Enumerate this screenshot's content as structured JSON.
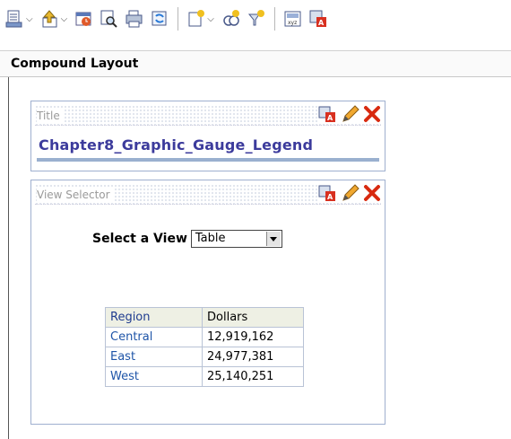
{
  "toolbar": {
    "icons": [
      "print-icon",
      "export-icon",
      "schedule-icon",
      "preview-icon",
      "save-icon",
      "refresh-icon",
      "new-view-icon",
      "insert-object-icon",
      "filter-icon",
      "format-icon",
      "delete-format-icon"
    ]
  },
  "compound": {
    "title": "Compound Layout"
  },
  "title_view": {
    "label": "Title",
    "text": "Chapter8_Graphic_Gauge_Legend"
  },
  "view_selector": {
    "label": "View Selector",
    "select_label": "Select a View",
    "selected": "Table"
  },
  "table": {
    "headers": [
      "Region",
      "Dollars"
    ],
    "rows": [
      {
        "region": "Central",
        "dollars": "12,919,162"
      },
      {
        "region": "East",
        "dollars": "24,977,381"
      },
      {
        "region": "West",
        "dollars": "25,140,251"
      }
    ]
  }
}
